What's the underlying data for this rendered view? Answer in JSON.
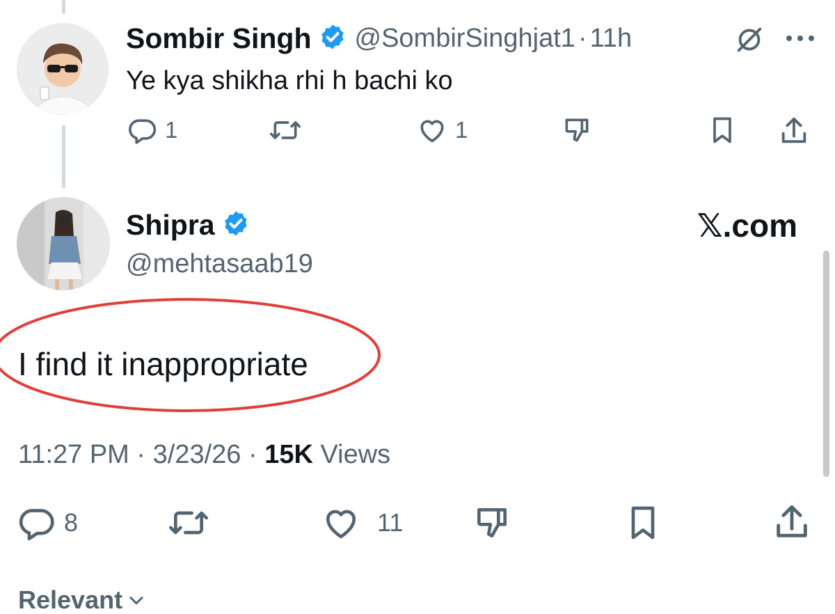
{
  "reply": {
    "display_name": "Sombir Singh",
    "handle": "@SombirSinghjat1",
    "separator": "·",
    "time": "11h",
    "text": "Ye kya shikha rhi h bachi ko",
    "reply_count": "1",
    "like_count": "1"
  },
  "main": {
    "display_name": "Shipra",
    "handle": "@mehtasaab19",
    "watermark": "𝕏.com",
    "text": "I find it inappropriate",
    "annotation_color": "#e0403a",
    "meta": {
      "time": "11:27 PM",
      "dot1": "·",
      "date": "3/23/26",
      "dot2": "·",
      "views_count": "15K",
      "views_label": "Views"
    },
    "reply_count": "8",
    "like_count": "11"
  },
  "footer": {
    "label": "Relevant"
  },
  "colors": {
    "text": "#0f1419",
    "muted": "#536471",
    "verified": "#1d9bf0",
    "line": "#cfd9de"
  },
  "icons": [
    "reply-icon",
    "repost-icon",
    "like-icon",
    "dislike-icon",
    "bookmark-icon",
    "share-icon",
    "grok-icon",
    "more-icon",
    "verified-badge-icon",
    "chevron-down-icon"
  ]
}
